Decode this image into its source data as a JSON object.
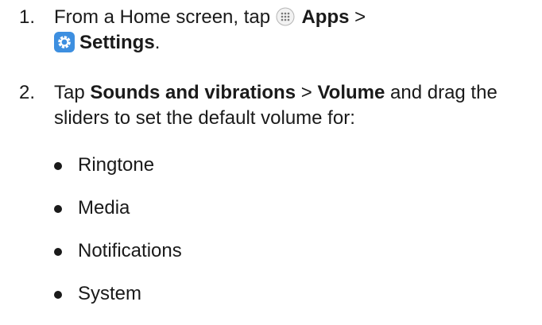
{
  "steps": [
    {
      "number": "1.",
      "text_from": "From a Home screen, tap",
      "apps_label": "Apps",
      "sep": ">",
      "settings_label": "Settings",
      "end": "."
    },
    {
      "number": "2.",
      "text_tap": "Tap",
      "sounds_label": "Sounds and vibrations",
      "sep": ">",
      "volume_label": "Volume",
      "text_rest": "and drag the sliders to set the default volume for:"
    }
  ],
  "bullets": [
    "Ringtone",
    "Media",
    "Notifications",
    "System"
  ],
  "icons": {
    "apps": "apps-grid-icon",
    "settings": "settings-gear-icon"
  },
  "colors": {
    "text": "#1a1a1a",
    "settings_icon_bg": "#3d8fe0"
  }
}
